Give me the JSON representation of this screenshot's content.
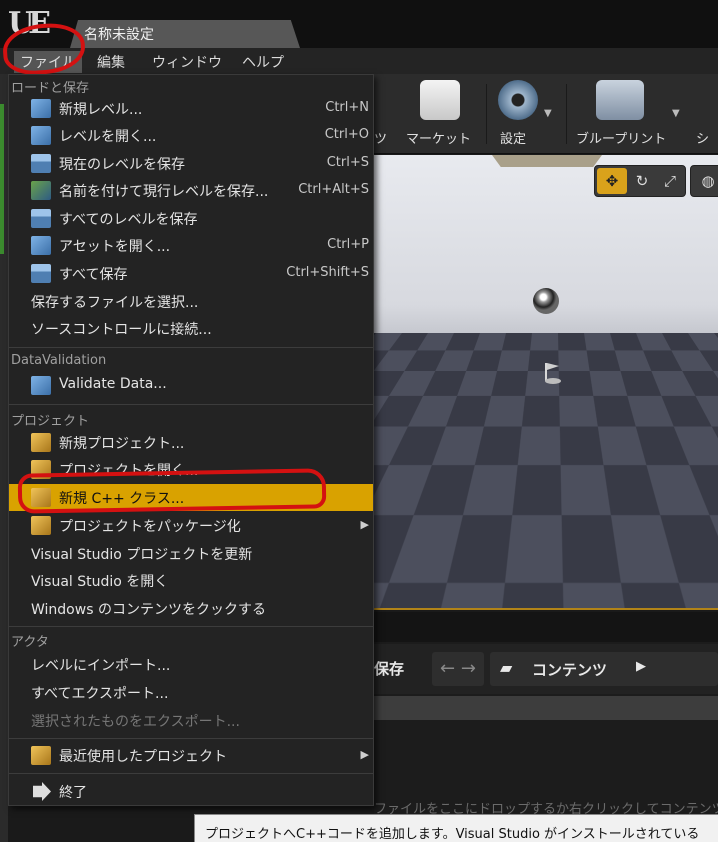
{
  "window": {
    "level_title": "名称未設定"
  },
  "menubar": {
    "items": [
      "ファイル",
      "編集",
      "ウィンドウ",
      "ヘルプ"
    ]
  },
  "toolbar": {
    "partial_label": "ツ",
    "items": [
      "マーケット",
      "設定",
      "ブループリント",
      "シ"
    ]
  },
  "file_menu": {
    "sections": [
      {
        "heading": "ロードと保存",
        "items": [
          {
            "label": "新規レベル...",
            "shortcut": "Ctrl+N",
            "icon": "new-level-icon"
          },
          {
            "label": "レベルを開く...",
            "shortcut": "Ctrl+O",
            "icon": "open-level-icon"
          },
          {
            "label": "現在のレベルを保存",
            "shortcut": "Ctrl+S",
            "icon": "save-icon"
          },
          {
            "label": "名前を付けて現行レベルを保存...",
            "shortcut": "Ctrl+Alt+S",
            "icon": "save-as-icon"
          },
          {
            "label": "すべてのレベルを保存",
            "shortcut": "",
            "icon": "save-all-levels-icon"
          },
          {
            "label": "アセットを開く...",
            "shortcut": "Ctrl+P",
            "icon": "open-asset-icon"
          },
          {
            "label": "すべて保存",
            "shortcut": "Ctrl+Shift+S",
            "icon": "save-all-icon"
          },
          {
            "label": "保存するファイルを選択...",
            "shortcut": "",
            "icon": ""
          },
          {
            "label": "ソースコントロールに接続...",
            "shortcut": "",
            "icon": ""
          }
        ]
      },
      {
        "heading": "DataValidation",
        "items": [
          {
            "label": "Validate Data...",
            "shortcut": "",
            "icon": "validate-icon"
          }
        ]
      },
      {
        "heading": "プロジェクト",
        "items": [
          {
            "label": "新規プロジェクト...",
            "shortcut": "",
            "icon": "new-project-icon"
          },
          {
            "label": "プロジェクトを開く...",
            "shortcut": "",
            "icon": "open-project-icon"
          },
          {
            "label": "新規 C++ クラス...",
            "shortcut": "",
            "icon": "cpp-class-icon"
          },
          {
            "label": "プロジェクトをパッケージ化",
            "shortcut": "",
            "icon": "package-icon"
          },
          {
            "label": "Visual Studio プロジェクトを更新",
            "shortcut": "",
            "icon": ""
          },
          {
            "label": "Visual Studio を開く",
            "shortcut": "",
            "icon": ""
          },
          {
            "label": "Windows のコンテンツをクックする",
            "shortcut": "",
            "icon": ""
          }
        ]
      },
      {
        "heading": "アクタ",
        "items": [
          {
            "label": "レベルにインポート...",
            "shortcut": "",
            "icon": ""
          },
          {
            "label": "すべてエクスポート...",
            "shortcut": "",
            "icon": ""
          },
          {
            "label": "選択されたものをエクスポート...",
            "shortcut": "",
            "icon": ""
          }
        ]
      }
    ],
    "recent_projects": "最近使用したプロジェクト",
    "exit": "終了"
  },
  "content_browser": {
    "save_label": "保存",
    "path_label": "コンテンツ",
    "hint": "ファイルをここにドロップするか右クリックしてコンテンツを"
  },
  "tooltip": "プロジェクトへC++コードを追加します。Visual Studio がインストールされている"
}
